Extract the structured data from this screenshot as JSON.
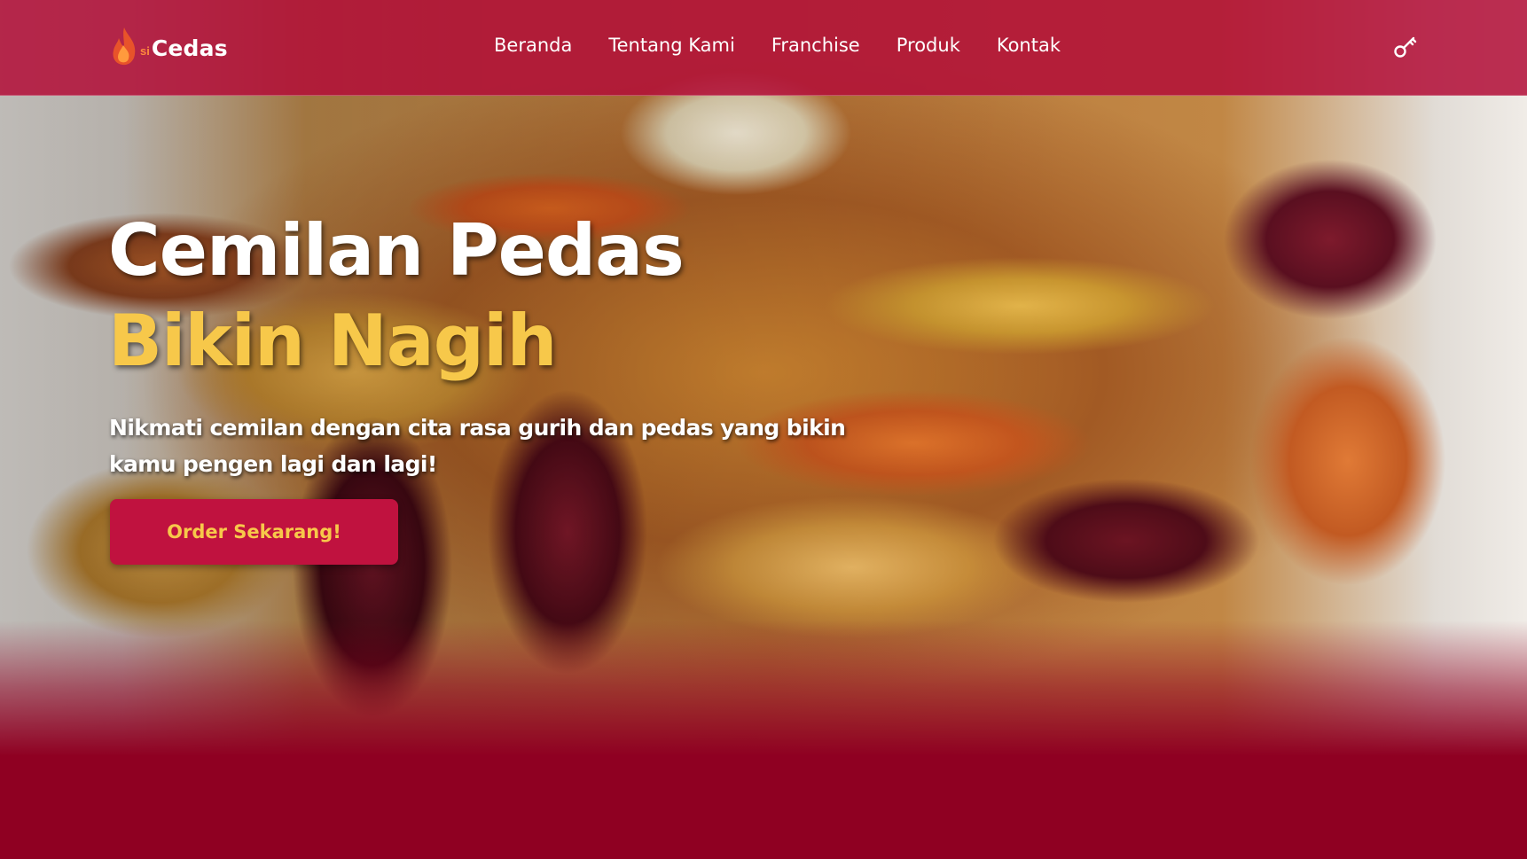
{
  "colors": {
    "brand_primary": "#b20e38",
    "accent_yellow": "#f7c84a",
    "dark_band": "#8f0022",
    "cta_background": "#c0123f"
  },
  "header": {
    "brand": {
      "icon": "flame-icon",
      "prefix": "si",
      "name": "Cedas"
    },
    "nav": [
      {
        "label": "Beranda"
      },
      {
        "label": "Tentang Kami"
      },
      {
        "label": "Franchise"
      },
      {
        "label": "Produk"
      },
      {
        "label": "Kontak"
      }
    ],
    "login_icon": "key-icon"
  },
  "hero": {
    "title_line1": "Cemilan Pedas",
    "title_line2": "Bikin Nagih",
    "subtitle": "Nikmati cemilan dengan cita rasa gurih dan pedas yang bikin kamu pengen lagi dan lagi!",
    "cta_label": "Order Sekarang!"
  }
}
